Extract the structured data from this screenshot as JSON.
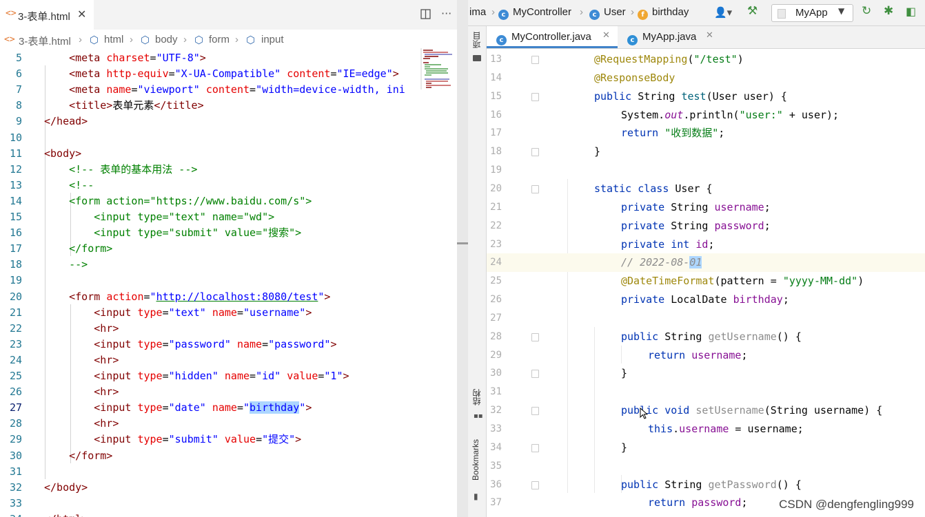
{
  "vscode": {
    "tab": {
      "label": "3-表单.html",
      "close": "✕"
    },
    "breadcrumbs": [
      "3-表单.html",
      "html",
      "body",
      "form",
      "input"
    ],
    "lines": [
      {
        "n": "5",
        "tokens": [
          [
            "t-tag",
            "    <meta "
          ],
          [
            "t-attr",
            "charset"
          ],
          [
            "t-txt",
            "="
          ],
          [
            "t-val",
            "\"UTF-8\""
          ],
          [
            "t-tag",
            ">"
          ]
        ]
      },
      {
        "n": "6",
        "tokens": [
          [
            "t-tag",
            "    <meta "
          ],
          [
            "t-attr",
            "http-equiv"
          ],
          [
            "t-txt",
            "="
          ],
          [
            "t-val",
            "\"X-UA-Compatible\""
          ],
          [
            "t-tag",
            " "
          ],
          [
            "t-attr",
            "content"
          ],
          [
            "t-txt",
            "="
          ],
          [
            "t-val",
            "\"IE=edge\""
          ],
          [
            "t-tag",
            ">"
          ]
        ]
      },
      {
        "n": "7",
        "tokens": [
          [
            "t-tag",
            "    <meta "
          ],
          [
            "t-attr",
            "name"
          ],
          [
            "t-txt",
            "="
          ],
          [
            "t-val",
            "\"viewport\""
          ],
          [
            "t-tag",
            " "
          ],
          [
            "t-attr",
            "content"
          ],
          [
            "t-txt",
            "="
          ],
          [
            "t-val",
            "\"width=device-width, ini"
          ]
        ]
      },
      {
        "n": "8",
        "tokens": [
          [
            "t-tag",
            "    <title>"
          ],
          [
            "t-txt",
            "表单元素"
          ],
          [
            "t-tag",
            "</title>"
          ]
        ]
      },
      {
        "n": "9",
        "tokens": [
          [
            "t-tag",
            "</head>"
          ]
        ]
      },
      {
        "n": "10",
        "tokens": []
      },
      {
        "n": "11",
        "tokens": [
          [
            "t-tag",
            "<body>"
          ]
        ]
      },
      {
        "n": "12",
        "tokens": [
          [
            "t-com",
            "    <!-- 表单的基本用法 -->"
          ]
        ]
      },
      {
        "n": "13",
        "tokens": [
          [
            "t-com",
            "    <!--"
          ]
        ]
      },
      {
        "n": "14",
        "tokens": [
          [
            "t-com",
            "    <form action=\""
          ],
          [
            "t-com",
            "https://www.baidu.com/s"
          ],
          [
            "t-com",
            "\">"
          ]
        ]
      },
      {
        "n": "15",
        "tokens": [
          [
            "t-com",
            "        <input type=\"text\" name=\"wd\">"
          ]
        ]
      },
      {
        "n": "16",
        "tokens": [
          [
            "t-com",
            "        <input type=\"submit\" value=\"搜索\">"
          ]
        ]
      },
      {
        "n": "17",
        "tokens": [
          [
            "t-com",
            "    </form>"
          ]
        ]
      },
      {
        "n": "18",
        "tokens": [
          [
            "t-com",
            "    -->"
          ]
        ]
      },
      {
        "n": "19",
        "tokens": []
      },
      {
        "n": "20",
        "tokens": [
          [
            "t-tag",
            "    <form "
          ],
          [
            "t-attr",
            "action"
          ],
          [
            "t-txt",
            "="
          ],
          [
            "t-val",
            "\""
          ],
          [
            "t-url",
            "http://localhost:8080/test"
          ],
          [
            "t-val",
            "\""
          ],
          [
            "t-tag",
            ">"
          ]
        ]
      },
      {
        "n": "21",
        "tokens": [
          [
            "t-tag",
            "        <input "
          ],
          [
            "t-attr",
            "type"
          ],
          [
            "t-txt",
            "="
          ],
          [
            "t-val",
            "\"text\""
          ],
          [
            "t-tag",
            " "
          ],
          [
            "t-attr",
            "name"
          ],
          [
            "t-txt",
            "="
          ],
          [
            "t-val",
            "\"username\""
          ],
          [
            "t-tag",
            ">"
          ]
        ]
      },
      {
        "n": "22",
        "tokens": [
          [
            "t-tag",
            "        <hr>"
          ]
        ]
      },
      {
        "n": "23",
        "tokens": [
          [
            "t-tag",
            "        <input "
          ],
          [
            "t-attr",
            "type"
          ],
          [
            "t-txt",
            "="
          ],
          [
            "t-val",
            "\"password\""
          ],
          [
            "t-tag",
            " "
          ],
          [
            "t-attr",
            "name"
          ],
          [
            "t-txt",
            "="
          ],
          [
            "t-val",
            "\"password\""
          ],
          [
            "t-tag",
            ">"
          ]
        ]
      },
      {
        "n": "24",
        "tokens": [
          [
            "t-tag",
            "        <hr>"
          ]
        ]
      },
      {
        "n": "25",
        "tokens": [
          [
            "t-tag",
            "        <input "
          ],
          [
            "t-attr",
            "type"
          ],
          [
            "t-txt",
            "="
          ],
          [
            "t-val",
            "\"hidden\""
          ],
          [
            "t-tag",
            " "
          ],
          [
            "t-attr",
            "name"
          ],
          [
            "t-txt",
            "="
          ],
          [
            "t-val",
            "\"id\""
          ],
          [
            "t-tag",
            " "
          ],
          [
            "t-attr",
            "value"
          ],
          [
            "t-txt",
            "="
          ],
          [
            "t-val",
            "\"1\""
          ],
          [
            "t-tag",
            ">"
          ]
        ]
      },
      {
        "n": "26",
        "tokens": [
          [
            "t-tag",
            "        <hr>"
          ]
        ]
      },
      {
        "n": "27",
        "tokens": [
          [
            "t-tag",
            "        <input "
          ],
          [
            "t-attr",
            "type"
          ],
          [
            "t-txt",
            "="
          ],
          [
            "t-val",
            "\"date\""
          ],
          [
            "t-tag",
            " "
          ],
          [
            "t-attr",
            "name"
          ],
          [
            "t-txt",
            "="
          ],
          [
            "t-val",
            "\""
          ],
          [
            "t-val t-hl",
            "birthday"
          ],
          [
            "t-val",
            "\""
          ],
          [
            "t-tag",
            ">"
          ]
        ]
      },
      {
        "n": "28",
        "tokens": [
          [
            "t-tag",
            "        <hr>"
          ]
        ]
      },
      {
        "n": "29",
        "tokens": [
          [
            "t-tag",
            "        <input "
          ],
          [
            "t-attr",
            "type"
          ],
          [
            "t-txt",
            "="
          ],
          [
            "t-val",
            "\"submit\""
          ],
          [
            "t-tag",
            " "
          ],
          [
            "t-attr",
            "value"
          ],
          [
            "t-txt",
            "="
          ],
          [
            "t-val",
            "\"提交\""
          ],
          [
            "t-tag",
            ">"
          ]
        ]
      },
      {
        "n": "30",
        "tokens": [
          [
            "t-tag",
            "    </form>"
          ]
        ]
      },
      {
        "n": "31",
        "tokens": []
      },
      {
        "n": "32",
        "tokens": [
          [
            "t-tag",
            "</body>"
          ]
        ]
      },
      {
        "n": "33",
        "tokens": []
      },
      {
        "n": "34",
        "tokens": [
          [
            "t-tag",
            "</html>"
          ]
        ]
      }
    ],
    "current_line": "27"
  },
  "intellij": {
    "nav": {
      "crumb_root": "ima",
      "crumb_class": "MyController",
      "crumb_inner": "User",
      "crumb_field": "birthday",
      "run_config": "MyApp"
    },
    "sidebar": {
      "project": "项目",
      "structure": "结构",
      "bookmarks": "Bookmarks"
    },
    "tabs": [
      {
        "label": "MyController.java",
        "active": true
      },
      {
        "label": "MyApp.java",
        "active": false
      }
    ],
    "lines": [
      {
        "n": "13",
        "indent": 1,
        "tokens": [
          [
            "ann",
            "@RequestMapping"
          ],
          [
            "",
            "("
          ],
          [
            "str",
            "\"/test\""
          ],
          [
            "",
            ")"
          ]
        ]
      },
      {
        "n": "14",
        "indent": 1,
        "tokens": [
          [
            "ann",
            "@ResponseBody"
          ]
        ]
      },
      {
        "n": "15",
        "indent": 1,
        "tokens": [
          [
            "k",
            "public "
          ],
          [
            "",
            "String "
          ],
          [
            "mth",
            "test"
          ],
          [
            "",
            "(User user) {"
          ]
        ]
      },
      {
        "n": "16",
        "indent": 2,
        "tokens": [
          [
            "",
            "System."
          ],
          [
            "st",
            "out"
          ],
          [
            "",
            ".println("
          ],
          [
            "str",
            "\"user:\""
          ],
          [
            "",
            " + user);"
          ]
        ]
      },
      {
        "n": "17",
        "indent": 2,
        "tokens": [
          [
            "k",
            "return "
          ],
          [
            "str",
            "\"收到数据\""
          ],
          [
            "",
            ";"
          ]
        ]
      },
      {
        "n": "18",
        "indent": 1,
        "tokens": [
          [
            "",
            "}"
          ]
        ]
      },
      {
        "n": "19",
        "indent": 0,
        "tokens": []
      },
      {
        "n": "20",
        "indent": 1,
        "tokens": [
          [
            "k",
            "static class "
          ],
          [
            "",
            "User {"
          ]
        ]
      },
      {
        "n": "21",
        "indent": 2,
        "tokens": [
          [
            "k",
            "private "
          ],
          [
            "",
            "String "
          ],
          [
            "fld",
            "username"
          ],
          [
            "",
            ";"
          ]
        ]
      },
      {
        "n": "22",
        "indent": 2,
        "tokens": [
          [
            "k",
            "private "
          ],
          [
            "",
            "String "
          ],
          [
            "fld",
            "password"
          ],
          [
            "",
            ";"
          ]
        ]
      },
      {
        "n": "23",
        "indent": 2,
        "tokens": [
          [
            "k",
            "private int "
          ],
          [
            "fld",
            "id"
          ],
          [
            "",
            ";"
          ]
        ]
      },
      {
        "n": "24",
        "indent": 2,
        "tokens": [
          [
            "cm",
            "// 2022-08-"
          ],
          [
            "cm t-hl",
            "01"
          ]
        ]
      },
      {
        "n": "25",
        "indent": 2,
        "tokens": [
          [
            "ann",
            "@DateTimeFormat"
          ],
          [
            "",
            "(pattern = "
          ],
          [
            "str",
            "\"yyyy-MM-dd\""
          ],
          [
            "",
            ")"
          ]
        ]
      },
      {
        "n": "26",
        "indent": 2,
        "tokens": [
          [
            "k",
            "private "
          ],
          [
            "",
            "LocalDate "
          ],
          [
            "fld",
            "birthday"
          ],
          [
            "",
            ";"
          ]
        ]
      },
      {
        "n": "27",
        "indent": 0,
        "tokens": []
      },
      {
        "n": "28",
        "indent": 2,
        "tokens": [
          [
            "k",
            "public "
          ],
          [
            "",
            "String "
          ],
          [
            "gray",
            "getUsername"
          ],
          [
            "",
            "() {"
          ]
        ]
      },
      {
        "n": "29",
        "indent": 3,
        "tokens": [
          [
            "k",
            "return "
          ],
          [
            "fld",
            "username"
          ],
          [
            "",
            ";"
          ]
        ]
      },
      {
        "n": "30",
        "indent": 2,
        "tokens": [
          [
            "",
            "}"
          ]
        ]
      },
      {
        "n": "31",
        "indent": 0,
        "tokens": []
      },
      {
        "n": "32",
        "indent": 2,
        "tokens": [
          [
            "k",
            "public "
          ],
          [
            "k",
            "void "
          ],
          [
            "gray",
            "setUsername"
          ],
          [
            "",
            "(String username) {"
          ]
        ]
      },
      {
        "n": "33",
        "indent": 3,
        "tokens": [
          [
            "k",
            "this"
          ],
          [
            "",
            "."
          ],
          [
            "fld",
            "username"
          ],
          [
            "",
            " = username;"
          ]
        ]
      },
      {
        "n": "34",
        "indent": 2,
        "tokens": [
          [
            "",
            "}"
          ]
        ]
      },
      {
        "n": "35",
        "indent": 0,
        "tokens": []
      },
      {
        "n": "36",
        "indent": 2,
        "tokens": [
          [
            "k",
            "public "
          ],
          [
            "",
            "String "
          ],
          [
            "gray",
            "getPassword"
          ],
          [
            "",
            "() {"
          ]
        ]
      },
      {
        "n": "37",
        "indent": 3,
        "tokens": [
          [
            "k",
            "return "
          ],
          [
            "fld",
            "password"
          ],
          [
            "",
            ";"
          ]
        ]
      }
    ],
    "current_line": "24"
  },
  "watermark": "CSDN @dengfengling999"
}
